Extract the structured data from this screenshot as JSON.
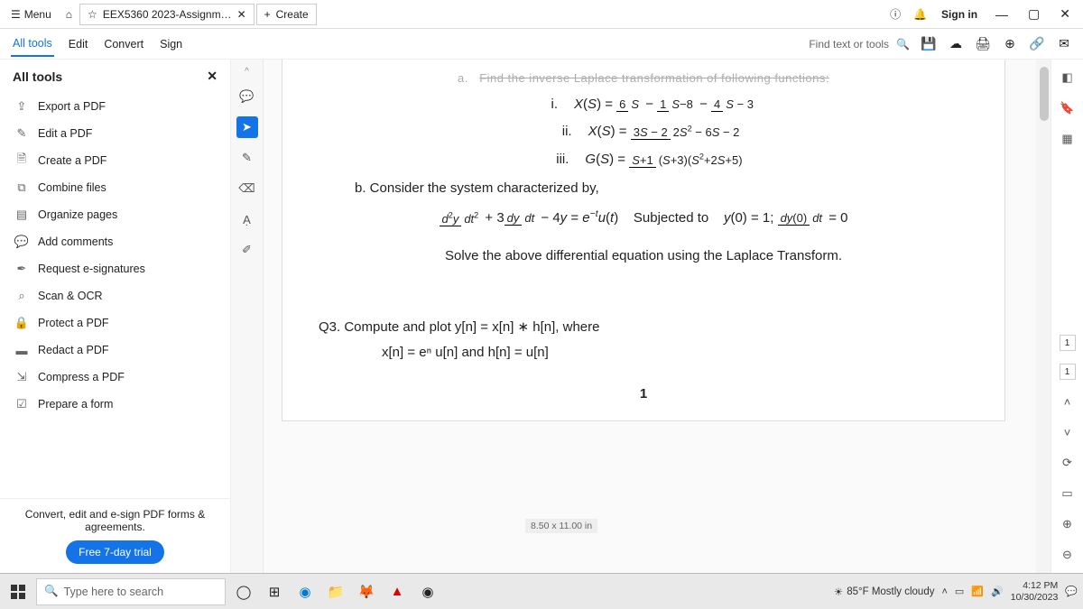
{
  "titlebar": {
    "menu": "Menu",
    "tab_title": "EEX5360 2023-Assignm…",
    "create": "Create",
    "signin": "Sign in"
  },
  "toolbar": {
    "tabs": [
      "All tools",
      "Edit",
      "Convert",
      "Sign"
    ],
    "find": "Find text or tools"
  },
  "sidebar": {
    "title": "All tools",
    "items": [
      {
        "label": "Export a PDF"
      },
      {
        "label": "Edit a PDF"
      },
      {
        "label": "Create a PDF"
      },
      {
        "label": "Combine files"
      },
      {
        "label": "Organize pages"
      },
      {
        "label": "Add comments"
      },
      {
        "label": "Request e-signatures"
      },
      {
        "label": "Scan & OCR"
      },
      {
        "label": "Protect a PDF"
      },
      {
        "label": "Redact a PDF"
      },
      {
        "label": "Compress a PDF"
      },
      {
        "label": "Prepare a form"
      }
    ],
    "promo": "Convert, edit and e-sign PDF forms & agreements.",
    "trial": "Free 7-day trial"
  },
  "doc": {
    "partial_top": "Find the inverse Laplace transformation of following functions:",
    "a": "a.",
    "i": "i.",
    "ii": "ii.",
    "iii": "iii.",
    "xs": "X(S) =",
    "gs": "G(S) =",
    "b": "b.   Consider the system characterized by,",
    "de_left": "d²y/dt² + 3 dy/dt − 4y = e⁻ᵗu(t)",
    "subjected": "Subjected    to",
    "ic": "y(0) = 1;  dy(0)/dt = 0",
    "solve": "Solve the above differential equation using the Laplace Transform.",
    "q3_title": "Q3.   Compute and plot y[n] = x[n] ∗ h[n], where",
    "q3_body": "x[n] = eⁿ u[n] and h[n] = u[n]",
    "pagenum": "1"
  },
  "right_rail": {
    "badge1": "1",
    "badge2": "1"
  },
  "status": {
    "dims": "8.50 x 11.00 in"
  },
  "taskbar": {
    "search_placeholder": "Type here to search",
    "weather": "85°F  Mostly cloudy",
    "time": "4:12 PM",
    "date": "10/30/2023"
  }
}
